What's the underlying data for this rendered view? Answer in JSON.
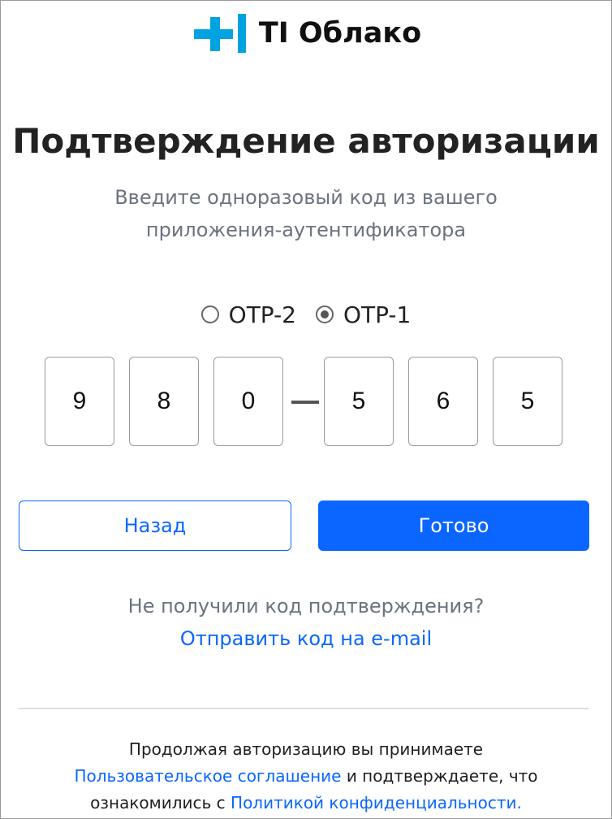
{
  "brand": {
    "name": "TI Облако",
    "logo_icon": "plus-bar-logo-icon",
    "color": "#00a3e0"
  },
  "page": {
    "title": "Подтверждение авторизации",
    "subtitle_line1": "Введите одноразовый код из вашего",
    "subtitle_line2": "приложения-аутентификатора"
  },
  "otp_mode": {
    "options": [
      {
        "label": "OTP-2",
        "selected": false
      },
      {
        "label": "OTP-1",
        "selected": true
      }
    ]
  },
  "code": {
    "digits": [
      "9",
      "8",
      "0",
      "5",
      "6",
      "5"
    ]
  },
  "buttons": {
    "back_label": "Назад",
    "done_label": "Готово"
  },
  "resend": {
    "question": "Не получили код подтверждения?",
    "link": "Отправить код на e-mail"
  },
  "footer": {
    "line1": "Продолжая авторизацию вы принимаете",
    "terms_link": "Пользовательское соглашение",
    "middle_text": " и подтверждаете, что",
    "line3_prefix": "ознакомились с ",
    "privacy_link": "Политикой конфиденциальности."
  },
  "colors": {
    "accent": "#0a66ff",
    "muted_text": "#6b7280",
    "logo": "#00a3e0"
  }
}
